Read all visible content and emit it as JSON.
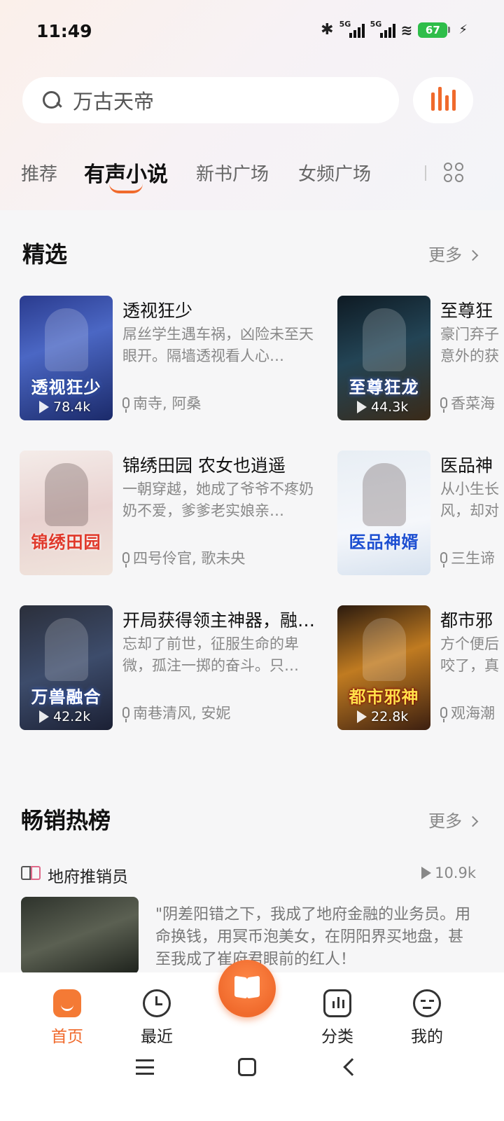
{
  "status_bar": {
    "time": "11:49",
    "signal_label_1": "5G",
    "signal_label_2": "5G",
    "battery": "67"
  },
  "search": {
    "query": "万古天帝"
  },
  "tabs": [
    {
      "label": "推荐"
    },
    {
      "label": "有声小说"
    },
    {
      "label": "新书广场"
    },
    {
      "label": "女频广场"
    }
  ],
  "featured": {
    "title": "精选",
    "more": "更多",
    "books": [
      {
        "title": "透视狂少",
        "cover_text": "透视狂少",
        "desc": "屌丝学生遇车祸，凶险未至天眼开。隔墙透视看人心…",
        "author": "南寺, 阿桑",
        "plays": "78.4k"
      },
      {
        "title": "至尊狂",
        "cover_text": "至尊狂龙",
        "desc": "豪门弃子意外的获",
        "author": "香菜海",
        "plays": "44.3k"
      },
      {
        "title": "锦绣田园 农女也逍遥",
        "cover_text": "锦绣田园",
        "desc": "一朝穿越，她成了爷爷不疼奶奶不爱，爹爹老实娘亲…",
        "author": "四号伶官, 歌未央",
        "plays": ""
      },
      {
        "title": "医品神",
        "cover_text": "医品神婿",
        "desc": "从小生长风，却对",
        "author": "三生谛",
        "plays": ""
      },
      {
        "title": "开局获得领主神器，融…",
        "cover_text": "万兽融合",
        "desc": "忘却了前世，征服生命的卑微，孤注一掷的奋斗。只…",
        "author": "南巷清风, 安妮",
        "plays": "42.2k"
      },
      {
        "title": "都市邪",
        "cover_text": "都市邪神",
        "desc": "方个便后咬了，真",
        "author": "观海潮",
        "plays": "22.8k"
      }
    ]
  },
  "bestseller": {
    "title": "畅销热榜",
    "more": "更多",
    "top_book": {
      "title": "地府推销员",
      "plays": "10.9k",
      "desc": "\"阴差阳错之下，我成了地府金融的业务员。用命换钱，用冥币泡美女，在阴阳界买地盘，甚至我成了崔府君眼前的红人！"
    }
  },
  "bottom_nav": [
    {
      "label": "首页",
      "icon": "home-icon"
    },
    {
      "label": "最近",
      "icon": "clock-icon"
    },
    {
      "label": "分类",
      "icon": "category-icon"
    },
    {
      "label": "我的",
      "icon": "profile-icon"
    }
  ],
  "colors": {
    "accent": "#f06a2c",
    "background": "#f6f6f7"
  }
}
